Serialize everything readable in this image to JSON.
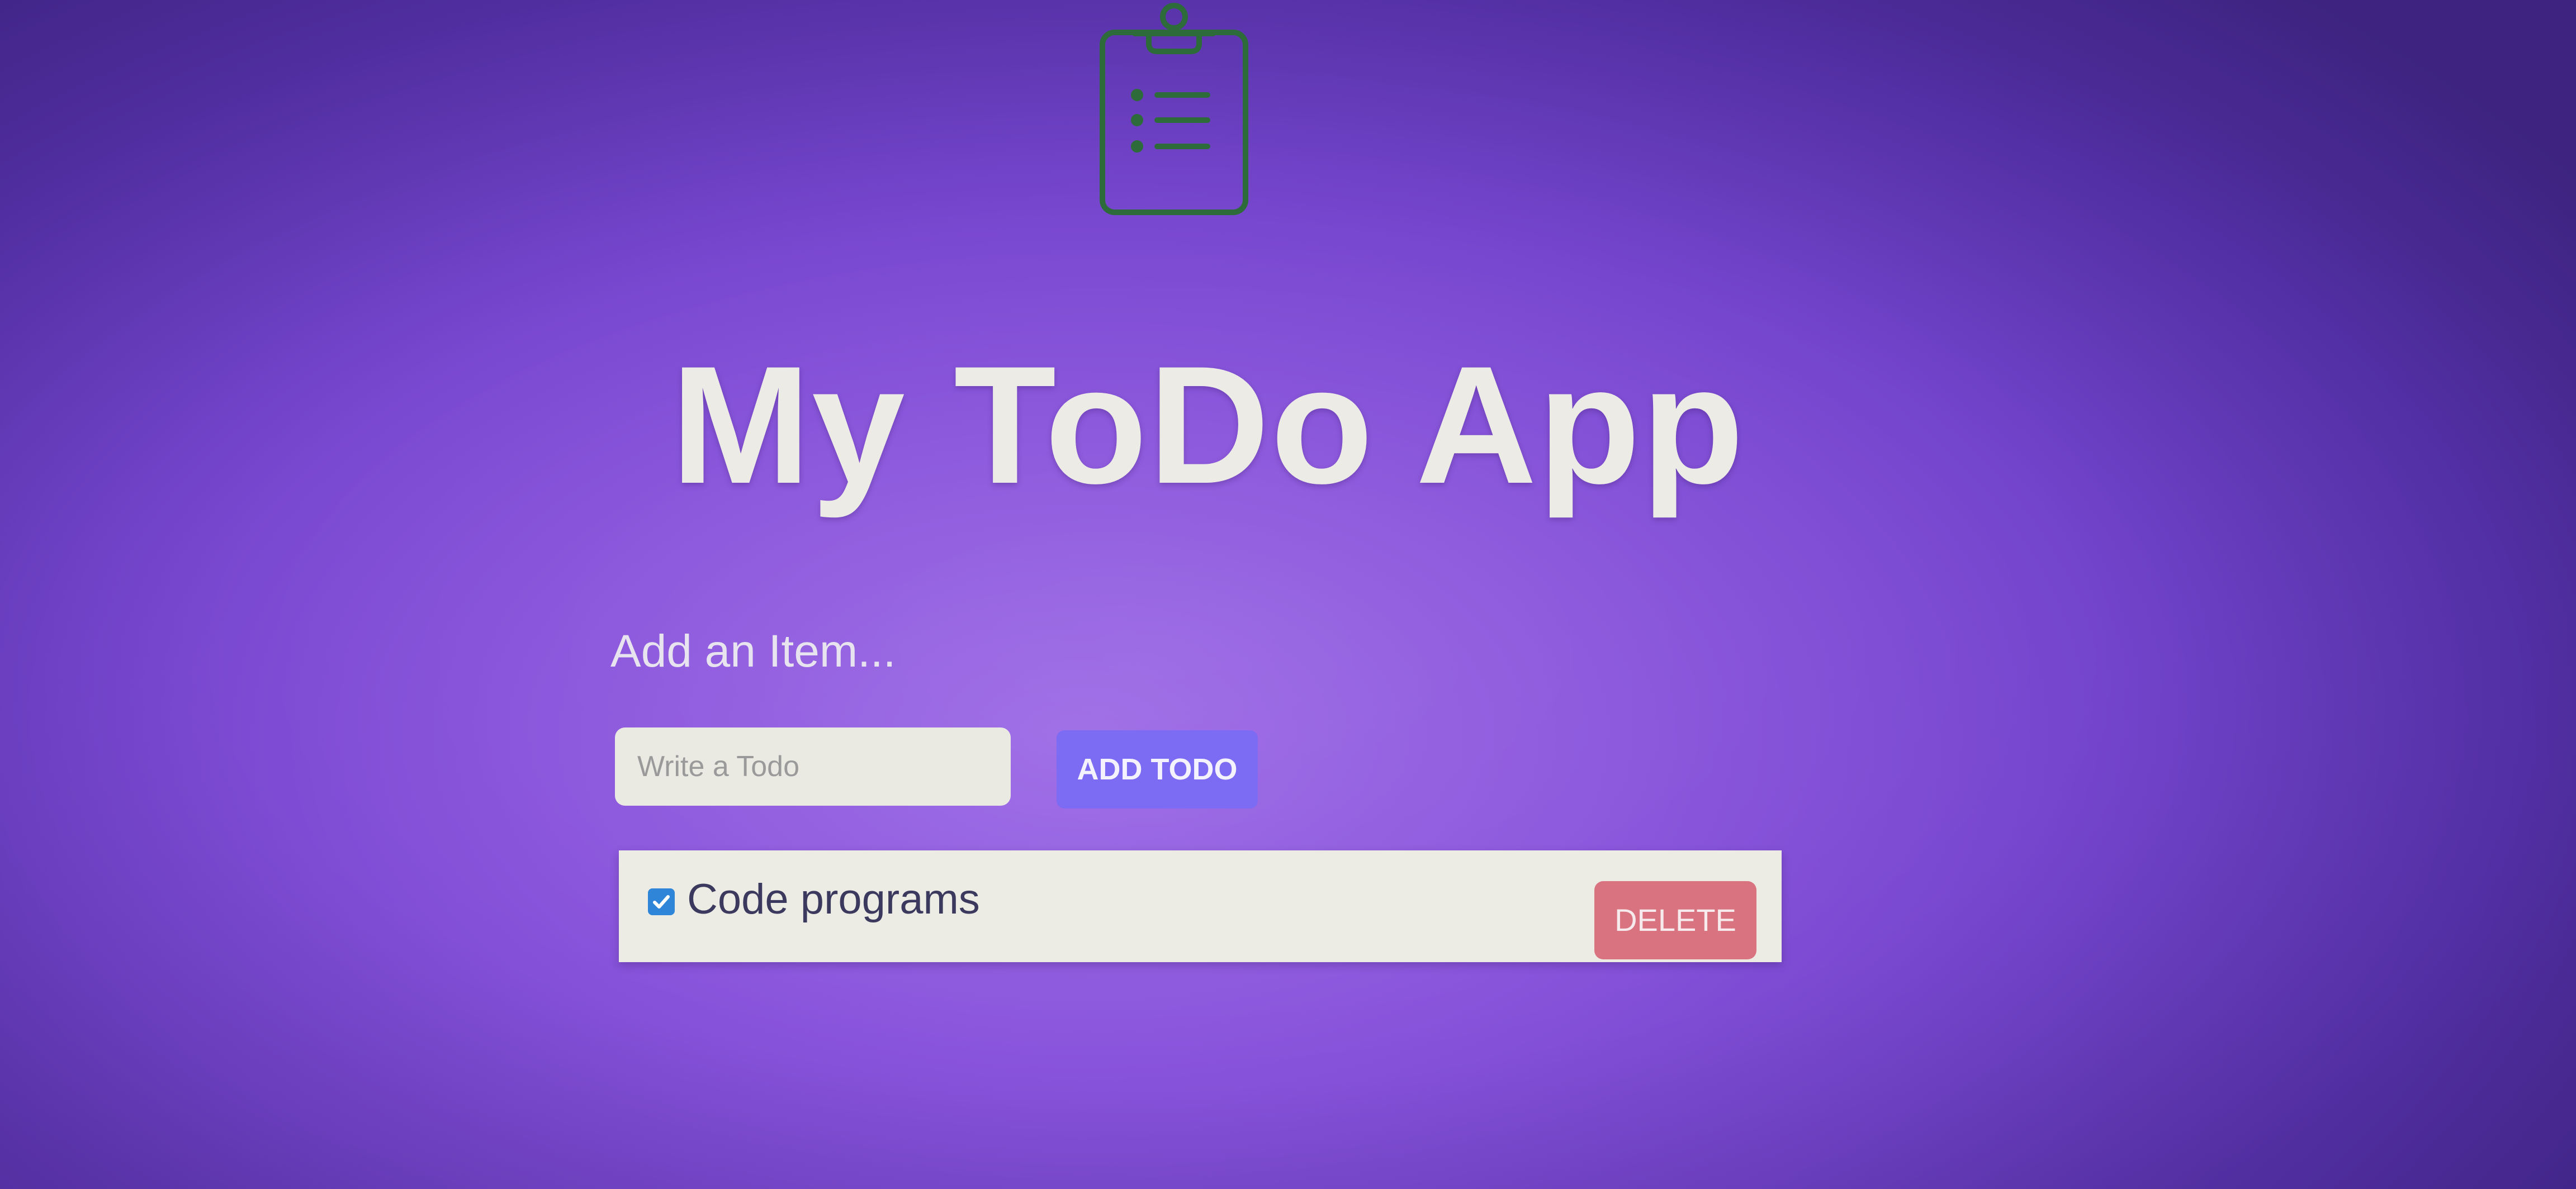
{
  "app": {
    "title": "My ToDo App",
    "logo_icon": "clipboard-list-icon",
    "logo_color": "#2e6b3a"
  },
  "form": {
    "heading": "Add an Item...",
    "input_placeholder": "Write a Todo",
    "input_value": "",
    "add_button_label": "ADD TODO",
    "add_button_color": "#7c6bf3"
  },
  "todos": [
    {
      "text": "Code programs",
      "checked": true,
      "delete_label": "DELETE",
      "delete_color": "#d9737f"
    }
  ],
  "colors": {
    "background": "#8a55dc",
    "title_text": "#ecebe6",
    "item_background": "#ecece4",
    "checkbox": "#2f86d8"
  }
}
